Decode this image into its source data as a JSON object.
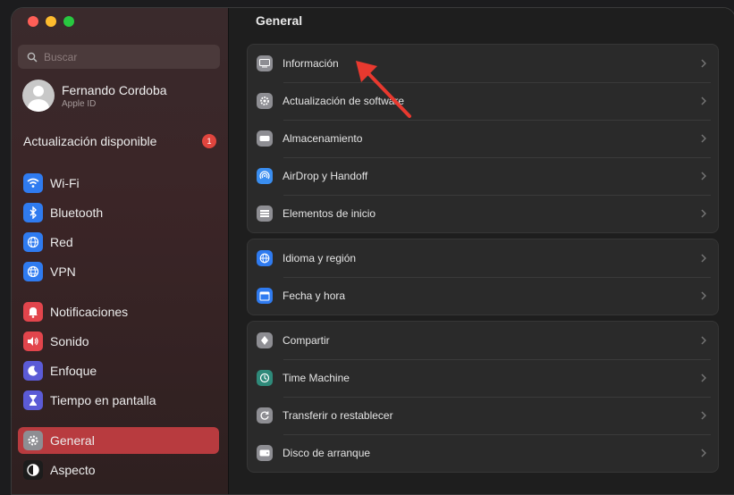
{
  "sidebar": {
    "search": {
      "placeholder": "Buscar"
    },
    "account": {
      "name": "Fernando Cordoba",
      "subtitle": "Apple ID"
    },
    "update": {
      "label": "Actualización disponible",
      "count": "1"
    },
    "items": [
      {
        "label": "Wi-Fi",
        "icon": "wifi-icon",
        "color": "#2f7bf0"
      },
      {
        "label": "Bluetooth",
        "icon": "bluetooth-icon",
        "color": "#2f7bf0"
      },
      {
        "label": "Red",
        "icon": "globe-icon",
        "color": "#2f7bf0"
      },
      {
        "label": "VPN",
        "icon": "vpn-globe-icon",
        "color": "#2f7bf0"
      },
      {
        "label": "Notificaciones",
        "icon": "bell-icon",
        "color": "#e2454c"
      },
      {
        "label": "Sonido",
        "icon": "speaker-icon",
        "color": "#e2454c"
      },
      {
        "label": "Enfoque",
        "icon": "moon-icon",
        "color": "#5b5bd6"
      },
      {
        "label": "Tiempo en pantalla",
        "icon": "hourglass-icon",
        "color": "#5b5bd6"
      },
      {
        "label": "General",
        "icon": "gear-icon",
        "color": "#8e8e93",
        "active": true
      },
      {
        "label": "Aspecto",
        "icon": "appearance-icon",
        "color": "#1c1c1c"
      }
    ]
  },
  "main": {
    "title": "General",
    "groups": [
      [
        {
          "label": "Información",
          "icon": "info-icon",
          "color": "#8e8e93"
        },
        {
          "label": "Actualización de software",
          "icon": "gear-badge-icon",
          "color": "#8e8e93"
        },
        {
          "label": "Almacenamiento",
          "icon": "drive-icon",
          "color": "#8e8e93"
        },
        {
          "label": "AirDrop y Handoff",
          "icon": "airdrop-icon",
          "color": "#3a8ef0"
        },
        {
          "label": "Elementos de inicio",
          "icon": "list-icon",
          "color": "#8e8e93"
        }
      ],
      [
        {
          "label": "Idioma y región",
          "icon": "globe-icon",
          "color": "#2f7bf0"
        },
        {
          "label": "Fecha y hora",
          "icon": "calendar-clock-icon",
          "color": "#2f7bf0"
        }
      ],
      [
        {
          "label": "Compartir",
          "icon": "share-icon",
          "color": "#8e8e93"
        },
        {
          "label": "Time Machine",
          "icon": "time-machine-icon",
          "color": "#2f8a7a"
        },
        {
          "label": "Transferir o restablecer",
          "icon": "reset-icon",
          "color": "#8e8e93"
        },
        {
          "label": "Disco de arranque",
          "icon": "disk-icon",
          "color": "#8e8e93"
        }
      ]
    ]
  },
  "annotation": {
    "arrow_color": "#e8392f"
  }
}
